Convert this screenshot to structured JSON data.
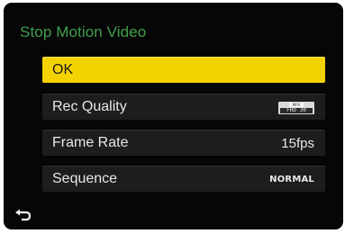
{
  "menu": {
    "title": "Stop Motion Video",
    "items": [
      {
        "label": "OK",
        "value": ""
      },
      {
        "label": "Rec Quality",
        "value": "",
        "icon": "rec-quality-icon",
        "icon_text_top": "MP4",
        "icon_text_bottom": "FHD 30"
      },
      {
        "label": "Frame Rate",
        "value": "15fps"
      },
      {
        "label": "Sequence",
        "value": "NORMAL"
      }
    ]
  },
  "footer": {
    "back_icon": "back-arrow-icon"
  },
  "colors": {
    "title": "#3fa04c",
    "selected_bg": "#f4d200",
    "item_bg": "#1d1d1d",
    "screen_bg": "#060606"
  }
}
